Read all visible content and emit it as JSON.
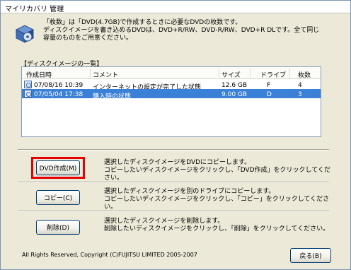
{
  "window": {
    "title": "マイリカバリ 管理"
  },
  "intro": {
    "line1": "「枚数」は「DVD(4.7GB)で作成するときに必要なDVDの枚数です。",
    "line2": "ディスクイメージを書き込めるDVDは、DVD+R/RW、DVD-R/RW、DVD+R DLです。全て同じ",
    "line3": "容量のものをご用意ください。"
  },
  "list": {
    "caption": "【ディスクイメージの一覧】",
    "headers": {
      "date": "作成日時",
      "comment": "コメント",
      "size": "サイズ",
      "drive": "ドライブ",
      "count": "枚数"
    },
    "rows": [
      {
        "date": "07/08/16 10:39",
        "comment": "インターネットの設定が完了した状態",
        "size": "12.6 GB",
        "drive": "F",
        "count": "4"
      },
      {
        "date": "07/05/04 17:38",
        "comment": "購入時の状態",
        "size": "9.00 GB",
        "drive": "D",
        "count": "3"
      }
    ]
  },
  "actions": {
    "dvd": {
      "label": "DVD作成(M)",
      "line1": "選択したディスクイメージをDVDにコピーします。",
      "line2": "コピーしたいディスクイメージをクリックし、「DVD作成」をクリックしてください。"
    },
    "copy": {
      "label": "コピー(C)",
      "line1": "選択したディスクイメージを別のドライブにコピーします。",
      "line2": "コピーしたいディスクイメージをクリックし、「コピー」をクリックしてください。"
    },
    "delete": {
      "label": "削除(D)",
      "line1": "選択したディスクイメージを削除します。",
      "line2": "削除したいディスクイメージをクリックし、「削除」をクリックしてください。"
    }
  },
  "footer": {
    "copyright": "All Rights Reserved, Copyright (C)FUJITSU LIMITED 2005-2007",
    "back_label": "戻る(B)"
  },
  "colors": {
    "selection": "#3a80d6",
    "highlight": "#e40000",
    "dialog_bg": "#ece9d8"
  }
}
